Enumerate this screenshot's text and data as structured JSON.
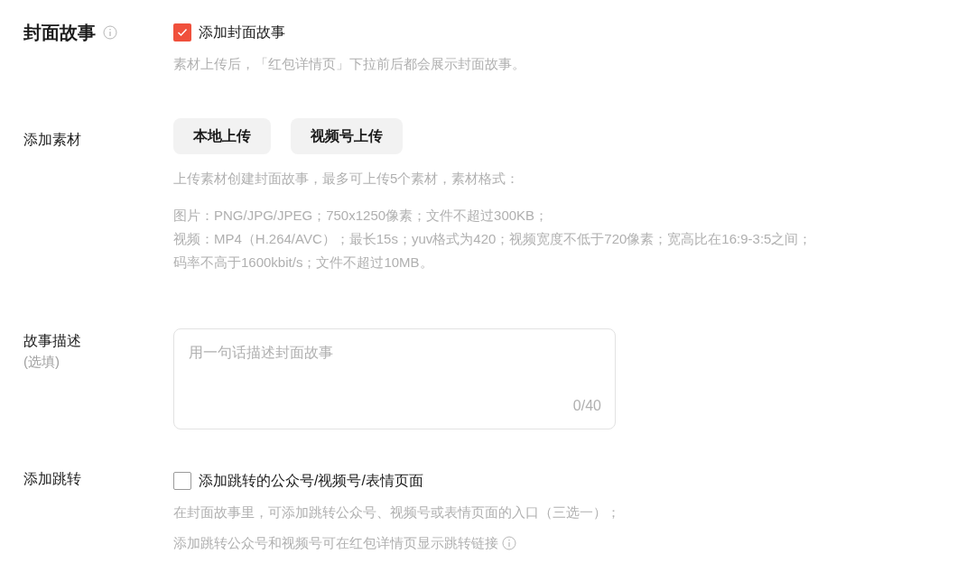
{
  "cover_story": {
    "title": "封面故事",
    "checkbox": {
      "label": "添加封面故事",
      "checked": true
    },
    "hint": "素材上传后，「红包详情页」下拉前后都会展示封面故事。"
  },
  "materials": {
    "label": "添加素材",
    "buttons": [
      "本地上传",
      "视频号上传"
    ],
    "hint": "上传素材创建封面故事，最多可上传5个素材，素材格式：",
    "formats": [
      "图片：PNG/JPG/JPEG；750x1250像素；文件不超过300KB；",
      "视频：MP4（H.264/AVC）；最长15s；yuv格式为420；视频宽度不低于720像素；宽高比在16:9-3:5之间；",
      "码率不高于1600kbit/s；文件不超过10MB。"
    ]
  },
  "description": {
    "label": "故事描述",
    "sublabel": "(选填)",
    "placeholder": "用一句话描述封面故事",
    "counter": "0/40"
  },
  "jump": {
    "label": "添加跳转",
    "checkbox": {
      "label": "添加跳转的公众号/视频号/表情页面",
      "checked": false
    },
    "hints": [
      "在封面故事里，可添加跳转公众号、视频号或表情页面的入口（三选一）；",
      "添加跳转公众号和视频号可在红包详情页显示跳转链接"
    ]
  }
}
